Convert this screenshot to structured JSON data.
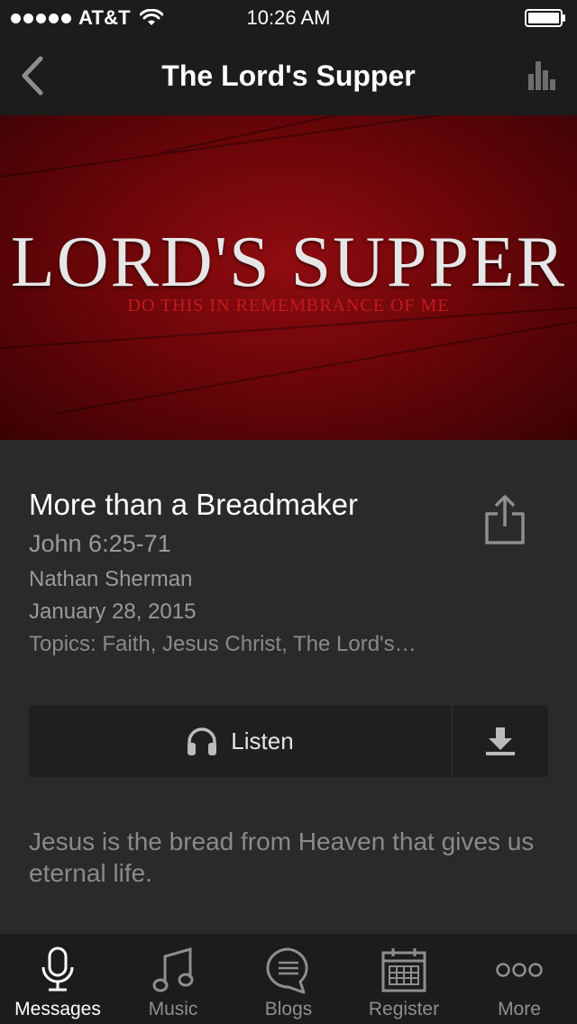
{
  "status_bar": {
    "carrier": "AT&T",
    "time": "10:26 AM",
    "signal_icon": "signal-dots-icon",
    "wifi_icon": "wifi-icon",
    "battery_icon": "battery-icon"
  },
  "nav": {
    "title": "The Lord's Supper",
    "back_icon": "chevron-left-icon",
    "stats_icon": "bar-chart-icon"
  },
  "hero": {
    "title": "LORD'S SUPPER",
    "subtitle": "DO THIS IN REMEMBRANCE OF ME"
  },
  "message": {
    "title": "More than a Breadmaker",
    "scripture": "John 6:25-71",
    "speaker": "Nathan Sherman",
    "date": "January 28, 2015",
    "topics": "Topics: Faith, Jesus Christ, The Lord's…",
    "share_icon": "share-icon"
  },
  "actions": {
    "listen_label": "Listen",
    "listen_icon": "headphones-icon",
    "download_icon": "download-icon"
  },
  "description": "Jesus is the bread from Heaven that gives us eternal life.",
  "tabs": [
    {
      "label": "Messages",
      "icon": "microphone-icon",
      "active": true
    },
    {
      "label": "Music",
      "icon": "music-note-icon",
      "active": false
    },
    {
      "label": "Blogs",
      "icon": "speech-bubble-icon",
      "active": false
    },
    {
      "label": "Register",
      "icon": "calendar-icon",
      "active": false
    },
    {
      "label": "More",
      "icon": "more-dots-icon",
      "active": false
    }
  ],
  "colors": {
    "background": "#262626",
    "bar_background": "#1c1c1c",
    "hero_red": "#8f0c10",
    "subtitle_red": "#c21b1f",
    "muted_text": "#9a9a9a"
  }
}
